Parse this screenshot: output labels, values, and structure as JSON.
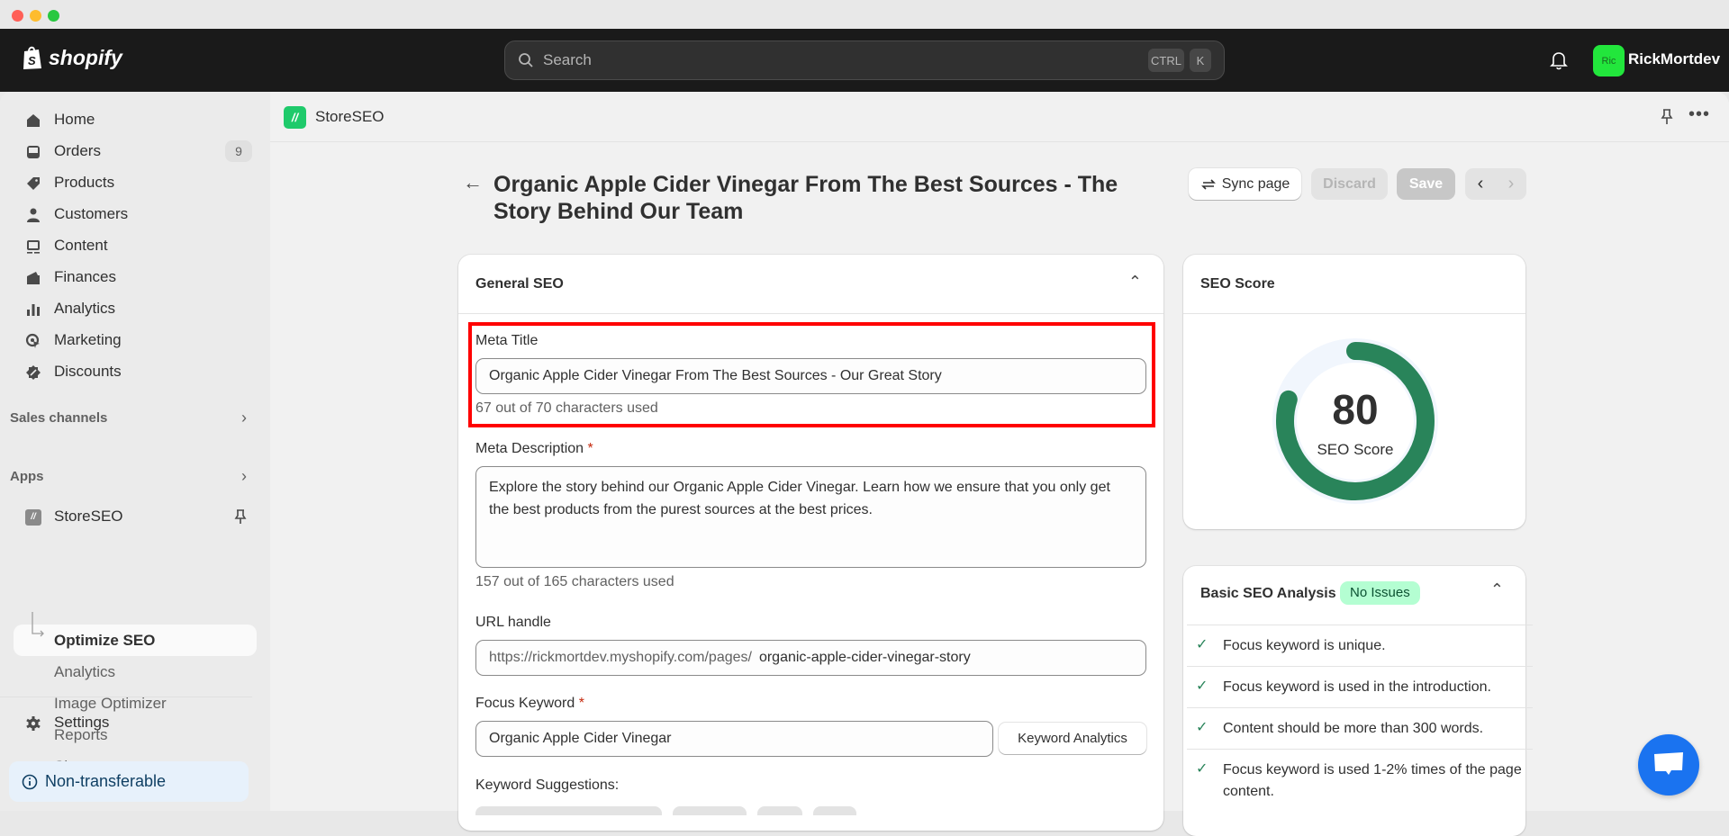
{
  "window": {
    "traffic_lights": [
      "#ff5f57",
      "#febc2e",
      "#28c840"
    ]
  },
  "topbar": {
    "brand": "shopify",
    "search_placeholder": "Search",
    "shortcut_keys": [
      "CTRL",
      "K"
    ],
    "user_initials": "Ric",
    "user_name": "RickMortdev"
  },
  "sidebar": {
    "items": [
      {
        "label": "Home",
        "icon": "home-icon"
      },
      {
        "label": "Orders",
        "icon": "inbox-icon",
        "badge": "9"
      },
      {
        "label": "Products",
        "icon": "tag-icon"
      },
      {
        "label": "Customers",
        "icon": "person-icon"
      },
      {
        "label": "Content",
        "icon": "image-icon"
      },
      {
        "label": "Finances",
        "icon": "wallet-icon"
      },
      {
        "label": "Analytics",
        "icon": "bar-chart-icon"
      },
      {
        "label": "Marketing",
        "icon": "target-icon"
      },
      {
        "label": "Discounts",
        "icon": "discount-icon"
      }
    ],
    "sales_channels_label": "Sales channels",
    "apps_label": "Apps",
    "app": {
      "name": "StoreSEO",
      "subitems": [
        "Optimize SEO",
        "Analytics",
        "Image Optimizer",
        "Reports",
        "Sitemaps"
      ],
      "active_subitem": "Optimize SEO"
    },
    "settings_label": "Settings",
    "non_transferable_label": "Non-transferable"
  },
  "app_header": {
    "name": "StoreSEO"
  },
  "page": {
    "title": "Organic Apple Cider Vinegar From The Best Sources - The Story Behind Our Team",
    "buttons": {
      "sync": "Sync page",
      "discard": "Discard",
      "save": "Save"
    }
  },
  "general_seo": {
    "title": "General SEO",
    "meta_title": {
      "label": "Meta Title",
      "value": "Organic Apple Cider Vinegar From The Best Sources - Our Great Story",
      "help": "67 out of 70 characters used"
    },
    "meta_description": {
      "label": "Meta Description",
      "required": "*",
      "value": "Explore the story behind our Organic Apple Cider Vinegar. Learn how we ensure that you only get the best products from the purest sources at the best prices.",
      "help": "157 out of 165 characters used"
    },
    "url_handle": {
      "label": "URL handle",
      "prefix": "https://rickmortdev.myshopify.com/pages/",
      "value": "organic-apple-cider-vinegar-story"
    },
    "focus_keyword": {
      "label": "Focus Keyword",
      "required": "*",
      "value": "Organic Apple Cider Vinegar",
      "analytics_button": "Keyword Analytics"
    },
    "keyword_suggestions_label": "Keyword Suggestions:"
  },
  "seo_score": {
    "title": "SEO Score",
    "score": 80,
    "max": 100,
    "caption": "SEO Score",
    "color": "#29845a"
  },
  "basic_analysis": {
    "title": "Basic SEO Analysis",
    "status_badge": "No Issues",
    "checks": [
      "Focus keyword is unique.",
      "Focus keyword is used in the introduction.",
      "Content should be more than 300 words.",
      "Focus keyword is used 1-2% times of the page content."
    ]
  }
}
